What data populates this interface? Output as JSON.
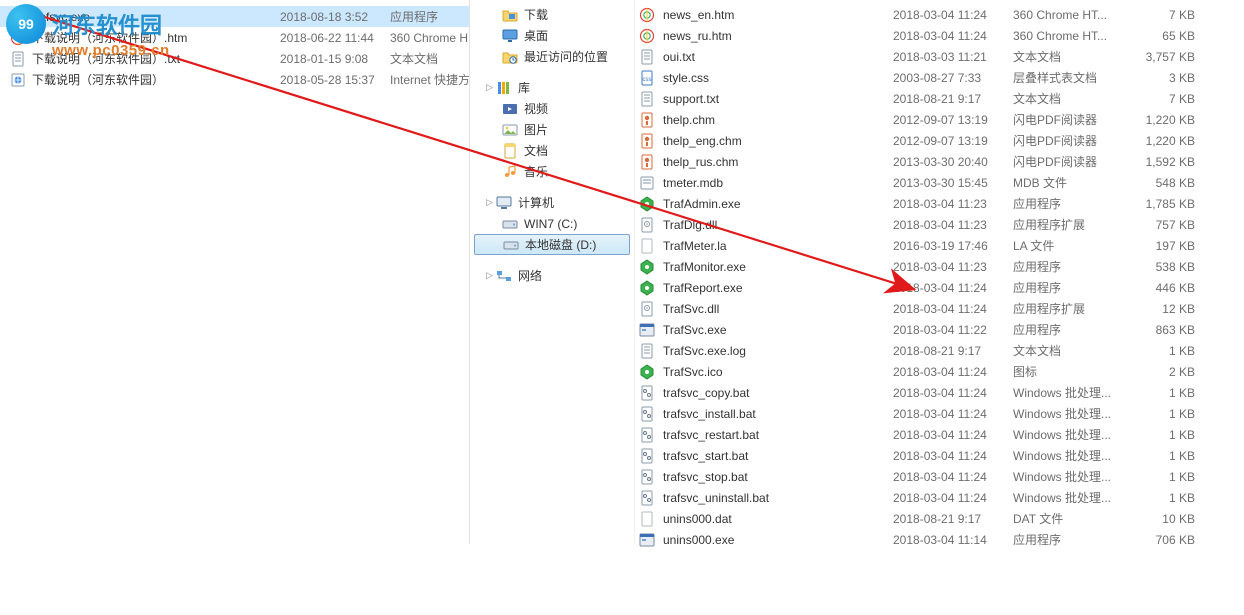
{
  "watermark": {
    "site_name": "河东软件园",
    "site_url": "www.pc0359.cn",
    "badge_text": "99"
  },
  "left_pane": {
    "files": [
      {
        "icon": "exe",
        "name": "trafsvc.exe",
        "date": "2018-08-18 3:52",
        "type": "应用程序",
        "selected": true
      },
      {
        "icon": "htm",
        "name": "下载说明（河东软件园）.htm",
        "date": "2018-06-22 11:44",
        "type": "360 Chrome H"
      },
      {
        "icon": "txt",
        "name": "下载说明（河东软件园）.txt",
        "date": "2018-01-15 9:08",
        "type": "文本文档"
      },
      {
        "icon": "url",
        "name": "下载说明（河东软件园）",
        "date": "2018-05-28 15:37",
        "type": "Internet 快捷方"
      }
    ]
  },
  "nav": {
    "groups": [
      {
        "items": [
          {
            "icon": "folder",
            "label": "下载",
            "lvl": 2
          },
          {
            "icon": "desktop",
            "label": "桌面",
            "lvl": 2
          },
          {
            "icon": "recent",
            "label": "最近访问的位置",
            "lvl": 2
          }
        ]
      },
      {
        "label": "库",
        "icon": "lib",
        "items": [
          {
            "icon": "video",
            "label": "视频",
            "lvl": 2
          },
          {
            "icon": "pic",
            "label": "图片",
            "lvl": 2
          },
          {
            "icon": "doc",
            "label": "文档",
            "lvl": 2
          },
          {
            "icon": "music",
            "label": "音乐",
            "lvl": 2
          }
        ]
      },
      {
        "label": "计算机",
        "icon": "computer",
        "items": [
          {
            "icon": "drive",
            "label": "WIN7 (C:)",
            "lvl": 2
          },
          {
            "icon": "drive",
            "label": "本地磁盘 (D:)",
            "lvl": 2,
            "selected": true
          }
        ]
      },
      {
        "label": "网络",
        "icon": "net",
        "items": []
      }
    ]
  },
  "right_pane": {
    "files": [
      {
        "icon": "htm",
        "name": "news_en.htm",
        "date": "2018-03-04 11:24",
        "type": "360 Chrome HT...",
        "size": "7 KB"
      },
      {
        "icon": "htm",
        "name": "news_ru.htm",
        "date": "2018-03-04 11:24",
        "type": "360 Chrome HT...",
        "size": "65 KB"
      },
      {
        "icon": "txt",
        "name": "oui.txt",
        "date": "2018-03-03 11:21",
        "type": "文本文档",
        "size": "3,757 KB"
      },
      {
        "icon": "css",
        "name": "style.css",
        "date": "2003-08-27 7:33",
        "type": "层叠样式表文档",
        "size": "3 KB"
      },
      {
        "icon": "txt",
        "name": "support.txt",
        "date": "2018-08-21 9:17",
        "type": "文本文档",
        "size": "7 KB"
      },
      {
        "icon": "chm",
        "name": "thelp.chm",
        "date": "2012-09-07 13:19",
        "type": "闪电PDF阅读器",
        "size": "1,220 KB"
      },
      {
        "icon": "chm",
        "name": "thelp_eng.chm",
        "date": "2012-09-07 13:19",
        "type": "闪电PDF阅读器",
        "size": "1,220 KB"
      },
      {
        "icon": "chm",
        "name": "thelp_rus.chm",
        "date": "2013-03-30 20:40",
        "type": "闪电PDF阅读器",
        "size": "1,592 KB"
      },
      {
        "icon": "mdb",
        "name": "tmeter.mdb",
        "date": "2013-03-30 15:45",
        "type": "MDB 文件",
        "size": "548 KB"
      },
      {
        "icon": "green",
        "name": "TrafAdmin.exe",
        "date": "2018-03-04 11:23",
        "type": "应用程序",
        "size": "1,785 KB"
      },
      {
        "icon": "dll",
        "name": "TrafDlg.dll",
        "date": "2018-03-04 11:23",
        "type": "应用程序扩展",
        "size": "757 KB"
      },
      {
        "icon": "la",
        "name": "TrafMeter.la",
        "date": "2016-03-19 17:46",
        "type": "LA 文件",
        "size": "197 KB"
      },
      {
        "icon": "green",
        "name": "TrafMonitor.exe",
        "date": "2018-03-04 11:23",
        "type": "应用程序",
        "size": "538 KB"
      },
      {
        "icon": "green",
        "name": "TrafReport.exe",
        "date": "2018-03-04 11:24",
        "type": "应用程序",
        "size": "446 KB"
      },
      {
        "icon": "dll",
        "name": "TrafSvc.dll",
        "date": "2018-03-04 11:24",
        "type": "应用程序扩展",
        "size": "12 KB"
      },
      {
        "icon": "exe",
        "name": "TrafSvc.exe",
        "date": "2018-03-04 11:22",
        "type": "应用程序",
        "size": "863 KB"
      },
      {
        "icon": "txt",
        "name": "TrafSvc.exe.log",
        "date": "2018-08-21 9:17",
        "type": "文本文档",
        "size": "1 KB"
      },
      {
        "icon": "green",
        "name": "TrafSvc.ico",
        "date": "2018-03-04 11:24",
        "type": "图标",
        "size": "2 KB"
      },
      {
        "icon": "bat",
        "name": "trafsvc_copy.bat",
        "date": "2018-03-04 11:24",
        "type": "Windows 批处理...",
        "size": "1 KB"
      },
      {
        "icon": "bat",
        "name": "trafsvc_install.bat",
        "date": "2018-03-04 11:24",
        "type": "Windows 批处理...",
        "size": "1 KB"
      },
      {
        "icon": "bat",
        "name": "trafsvc_restart.bat",
        "date": "2018-03-04 11:24",
        "type": "Windows 批处理...",
        "size": "1 KB"
      },
      {
        "icon": "bat",
        "name": "trafsvc_start.bat",
        "date": "2018-03-04 11:24",
        "type": "Windows 批处理...",
        "size": "1 KB"
      },
      {
        "icon": "bat",
        "name": "trafsvc_stop.bat",
        "date": "2018-03-04 11:24",
        "type": "Windows 批处理...",
        "size": "1 KB"
      },
      {
        "icon": "bat",
        "name": "trafsvc_uninstall.bat",
        "date": "2018-03-04 11:24",
        "type": "Windows 批处理...",
        "size": "1 KB"
      },
      {
        "icon": "dat",
        "name": "unins000.dat",
        "date": "2018-08-21 9:17",
        "type": "DAT 文件",
        "size": "10 KB"
      },
      {
        "icon": "exe",
        "name": "unins000.exe",
        "date": "2018-03-04 11:14",
        "type": "应用程序",
        "size": "706 KB"
      }
    ]
  }
}
